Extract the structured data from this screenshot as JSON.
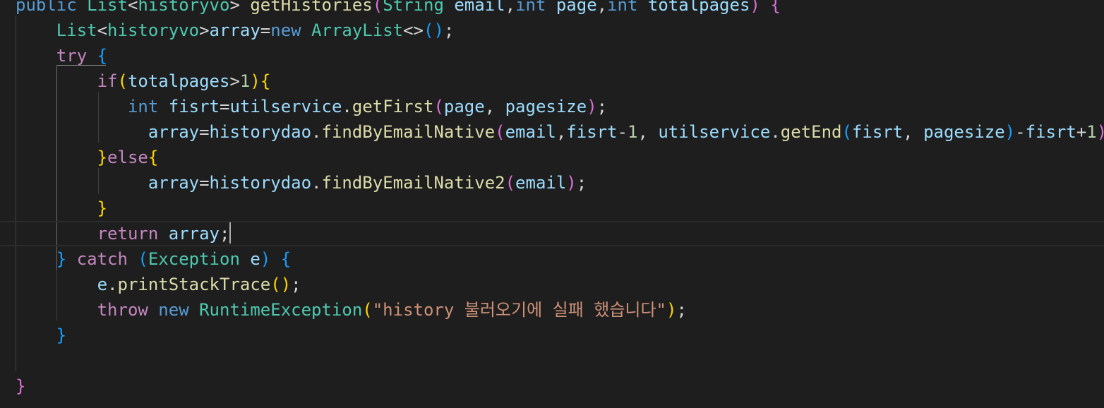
{
  "editor": {
    "lines": [
      [
        {
          "t": "public ",
          "c": "c-keyword"
        },
        {
          "t": "List",
          "c": "c-type"
        },
        {
          "t": "<",
          "c": "c-plain"
        },
        {
          "t": "historyvo",
          "c": "c-type"
        },
        {
          "t": "> ",
          "c": "c-plain"
        },
        {
          "t": "getHistories",
          "c": "c-func"
        },
        {
          "t": "(",
          "c": "c-brace-pink"
        },
        {
          "t": "String ",
          "c": "c-type"
        },
        {
          "t": "email",
          "c": "c-var"
        },
        {
          "t": ",",
          "c": "c-plain"
        },
        {
          "t": "int ",
          "c": "c-keyword"
        },
        {
          "t": "page",
          "c": "c-var"
        },
        {
          "t": ",",
          "c": "c-plain"
        },
        {
          "t": "int ",
          "c": "c-keyword"
        },
        {
          "t": "totalpages",
          "c": "c-var"
        },
        {
          "t": ") ",
          "c": "c-brace-pink"
        },
        {
          "t": "{",
          "c": "c-brace-pink"
        }
      ],
      [
        {
          "t": "    List",
          "c": "c-type"
        },
        {
          "t": "<",
          "c": "c-plain"
        },
        {
          "t": "historyvo",
          "c": "c-type"
        },
        {
          "t": ">",
          "c": "c-plain"
        },
        {
          "t": "array",
          "c": "c-var"
        },
        {
          "t": "=",
          "c": "c-plain"
        },
        {
          "t": "new ",
          "c": "c-keyword"
        },
        {
          "t": "ArrayList",
          "c": "c-type"
        },
        {
          "t": "<>",
          "c": "c-plain"
        },
        {
          "t": "()",
          "c": "c-brace-blue"
        },
        {
          "t": ";",
          "c": "c-plain"
        }
      ],
      [
        {
          "t": "    try ",
          "c": "c-control"
        },
        {
          "t": "{",
          "c": "c-brace-blue"
        }
      ],
      [
        {
          "t": "        if",
          "c": "c-control"
        },
        {
          "t": "(",
          "c": "c-brace-gold"
        },
        {
          "t": "totalpages",
          "c": "c-var"
        },
        {
          "t": ">",
          "c": "c-plain"
        },
        {
          "t": "1",
          "c": "c-num"
        },
        {
          "t": ")",
          "c": "c-brace-gold"
        },
        {
          "t": "{",
          "c": "c-brace-gold"
        }
      ],
      [
        {
          "t": "           int ",
          "c": "c-keyword"
        },
        {
          "t": "fisrt",
          "c": "c-var"
        },
        {
          "t": "=",
          "c": "c-plain"
        },
        {
          "t": "utilservice",
          "c": "c-var"
        },
        {
          "t": ".",
          "c": "c-plain"
        },
        {
          "t": "getFirst",
          "c": "c-func"
        },
        {
          "t": "(",
          "c": "c-brace-pink"
        },
        {
          "t": "page",
          "c": "c-var"
        },
        {
          "t": ", ",
          "c": "c-plain"
        },
        {
          "t": "pagesize",
          "c": "c-param"
        },
        {
          "t": ")",
          "c": "c-brace-pink"
        },
        {
          "t": ";",
          "c": "c-plain"
        }
      ],
      [
        {
          "t": "             array",
          "c": "c-var"
        },
        {
          "t": "=",
          "c": "c-plain"
        },
        {
          "t": "historydao",
          "c": "c-var"
        },
        {
          "t": ".",
          "c": "c-plain"
        },
        {
          "t": "findByEmailNative",
          "c": "c-func"
        },
        {
          "t": "(",
          "c": "c-brace-pink"
        },
        {
          "t": "email",
          "c": "c-var"
        },
        {
          "t": ",",
          "c": "c-plain"
        },
        {
          "t": "fisrt",
          "c": "c-var"
        },
        {
          "t": "-",
          "c": "c-plain"
        },
        {
          "t": "1",
          "c": "c-num"
        },
        {
          "t": ", ",
          "c": "c-plain"
        },
        {
          "t": "utilservice",
          "c": "c-var"
        },
        {
          "t": ".",
          "c": "c-plain"
        },
        {
          "t": "getEnd",
          "c": "c-func"
        },
        {
          "t": "(",
          "c": "c-brace-blue"
        },
        {
          "t": "fisrt",
          "c": "c-var"
        },
        {
          "t": ", ",
          "c": "c-plain"
        },
        {
          "t": "pagesize",
          "c": "c-param"
        },
        {
          "t": ")",
          "c": "c-brace-blue"
        },
        {
          "t": "-",
          "c": "c-plain"
        },
        {
          "t": "fisrt",
          "c": "c-var"
        },
        {
          "t": "+",
          "c": "c-plain"
        },
        {
          "t": "1",
          "c": "c-num"
        },
        {
          "t": ")",
          "c": "c-brace-pink"
        },
        {
          "t": ";",
          "c": "c-plain"
        }
      ],
      [
        {
          "t": "        }",
          "c": "c-brace-gold"
        },
        {
          "t": "else",
          "c": "c-control"
        },
        {
          "t": "{",
          "c": "c-brace-gold"
        }
      ],
      [
        {
          "t": "             array",
          "c": "c-var"
        },
        {
          "t": "=",
          "c": "c-plain"
        },
        {
          "t": "historydao",
          "c": "c-var"
        },
        {
          "t": ".",
          "c": "c-plain"
        },
        {
          "t": "findByEmailNative2",
          "c": "c-func"
        },
        {
          "t": "(",
          "c": "c-brace-pink"
        },
        {
          "t": "email",
          "c": "c-var"
        },
        {
          "t": ")",
          "c": "c-brace-pink"
        },
        {
          "t": ";",
          "c": "c-plain"
        }
      ],
      [
        {
          "t": "        }",
          "c": "c-brace-gold"
        }
      ],
      [
        {
          "t": "        return ",
          "c": "c-control"
        },
        {
          "t": "array",
          "c": "c-var"
        },
        {
          "t": ";",
          "c": "c-plain"
        }
      ],
      [
        {
          "t": "    }",
          "c": "c-brace-blue"
        },
        {
          "t": " catch ",
          "c": "c-control"
        },
        {
          "t": "(",
          "c": "c-brace-blue"
        },
        {
          "t": "Exception ",
          "c": "c-type"
        },
        {
          "t": "e",
          "c": "c-var"
        },
        {
          "t": ") ",
          "c": "c-brace-blue"
        },
        {
          "t": "{",
          "c": "c-brace-blue"
        }
      ],
      [
        {
          "t": "        e",
          "c": "c-var"
        },
        {
          "t": ".",
          "c": "c-plain"
        },
        {
          "t": "printStackTrace",
          "c": "c-func"
        },
        {
          "t": "()",
          "c": "c-brace-gold"
        },
        {
          "t": ";",
          "c": "c-plain"
        }
      ],
      [
        {
          "t": "        throw ",
          "c": "c-control"
        },
        {
          "t": "new ",
          "c": "c-keyword"
        },
        {
          "t": "RuntimeException",
          "c": "c-type"
        },
        {
          "t": "(",
          "c": "c-brace-gold"
        },
        {
          "t": "\"history 불러오기에 실패 했습니다\"",
          "c": "c-str"
        },
        {
          "t": ")",
          "c": "c-brace-gold"
        },
        {
          "t": ";",
          "c": "c-plain"
        }
      ],
      [
        {
          "t": "    }",
          "c": "c-brace-blue"
        }
      ],
      [],
      [
        {
          "t": "}",
          "c": "c-brace-pink"
        }
      ]
    ],
    "current_line_index": 9,
    "colors": {
      "background": "#1e1e1e",
      "keyword": "#569cd6",
      "control": "#c586c0",
      "type": "#4ec9b0",
      "function": "#dcdcaa",
      "variable": "#9cdcfe",
      "number": "#b5cea8",
      "string": "#ce9178"
    }
  }
}
